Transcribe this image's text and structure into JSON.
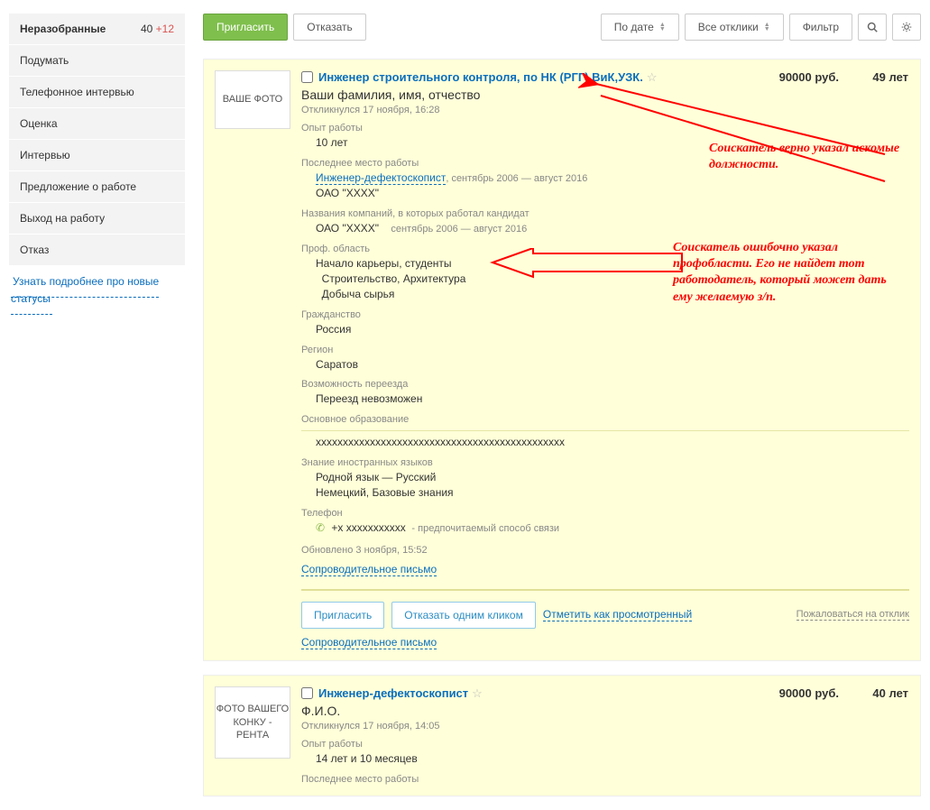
{
  "sidebar": {
    "items": [
      {
        "label": "Неразобранные",
        "count": "40",
        "extra": "+12"
      },
      {
        "label": "Подумать"
      },
      {
        "label": "Телефонное интервью"
      },
      {
        "label": "Оценка"
      },
      {
        "label": "Интервью"
      },
      {
        "label": "Предложение о работе"
      },
      {
        "label": "Выход на работу"
      },
      {
        "label": "Отказ"
      }
    ],
    "learn": "Узнать подробнее про новые статусы"
  },
  "topbar": {
    "invite": "Пригласить",
    "reject": "Отказать",
    "by_date": "По дате",
    "all_responses": "Все отклики",
    "filter": "Фильтр"
  },
  "responses": [
    {
      "photo": "ВАШЕ ФОТО",
      "title": "Инженер строительного контроля, по НК (РГГ),ВиК,УЗК.",
      "salary": "90000 руб.",
      "age": "49 лет",
      "fio": "Ваши фамилия, имя, отчество",
      "responded": "Откликнулся 17 ноября, 16:28",
      "exp_label": "Опыт работы",
      "exp_val": "10 лет",
      "lastjob_label": "Последнее место работы",
      "lastjob_role": "Инженер-дефектоскопист",
      "lastjob_dates": ", сентябрь 2006 — август 2016",
      "lastjob_company": "ОАО \"ХХХХ\"",
      "companies_label": "Названия компаний, в которых работал кандидат",
      "companies_val": "ОАО \"ХХХХ\"",
      "companies_dates": "сентябрь 2006 — август 2016",
      "prof_label": "Проф. область",
      "prof_val1": "Начало карьеры, студенты",
      "prof_val2": "Строительство, Архитектура",
      "prof_val3": "Добыча сырья",
      "citizen_label": "Гражданство",
      "citizen_val": "Россия",
      "region_label": "Регион",
      "region_val": "Саратов",
      "relocate_label": "Возможность переезда",
      "relocate_val": "Переезд невозможен",
      "edu_label": "Основное образование",
      "edu_val": "хххххххххххххххххххххххххххххххххххххххххххххх",
      "lang_label": "Знание иностранных языков",
      "lang_val1": "Родной язык — Русский",
      "lang_val2": "Немецкий, Базовые знания",
      "phone_label": "Телефон",
      "phone_val": "+х ххххххххххх",
      "phone_note": "- предпочитаемый способ связи",
      "updated": "Обновлено 3 ноября, 15:52",
      "cover_letter": "Сопроводительное письмо",
      "footer_invite": "Пригласить",
      "footer_reject": "Отказать одним кликом",
      "footer_mark": "Отметить как просмотренный",
      "complain": "Пожаловаться на отклик",
      "cover_letter2": "Сопроводительное письмо"
    },
    {
      "photo": "ФОТО ВАШЕГО КОНКУ - РЕНТА",
      "title": "Инженер-дефектоскопист",
      "salary": "90000 руб.",
      "age": "40 лет",
      "fio": "Ф.И.О.",
      "responded": "Откликнулся 17 ноября, 14:05",
      "exp_label": "Опыт работы",
      "exp_val": "14 лет и 10 месяцев",
      "lastjob_label": "Последнее место работы"
    }
  ],
  "annotations": {
    "a1": "Соискатель верно указал искомые должности.",
    "a2": "Соискатель ошибочно указал профобласти. Его не найдет тот работодатель, который может дать ему желаемую з/п."
  }
}
